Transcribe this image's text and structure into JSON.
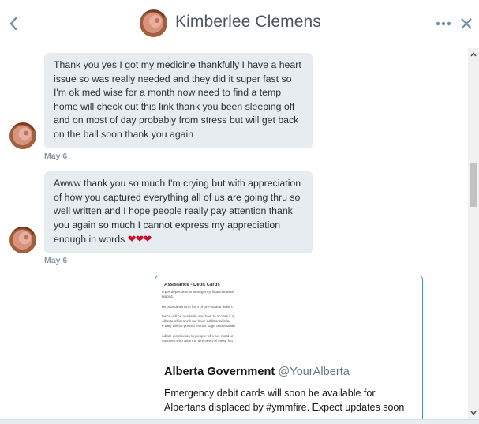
{
  "header": {
    "title": "Kimberlee Clemens",
    "back_icon": "chevron-left-icon",
    "more_icon": "more-icon",
    "close_icon": "close-icon"
  },
  "messages": [
    {
      "text": "Thank you yes I got my medicine thankfully I have a heart issue so was really needed and they did it super fast so I'm ok med wise for a month now need to find a temp home will check out this link thank you been sleeping off and on most of day probably from stress but will get back on the ball soon thank you again",
      "date": "May 6"
    },
    {
      "text": "Awww thank you so much I'm crying but with appreciation of how you captured everything all of us are going thru so well written and I hope people really pay attention thank you again so much I cannot express my appreciation enough in words",
      "emoji": "❤❤❤",
      "date": "May 6"
    }
  ],
  "tweet": {
    "image_title": "Assistance - Debit Cards",
    "image_lines": [
      "0 per dependent in emergency financial assis",
      "placed.",
      "",
      "be provided in the form of pre-loaded debit c",
      "",
      "tance will be available and how to access it w",
      "Alberta offices will not have additional infor",
      "e they will be posted on this page and availab",
      "",
      "ediate distribution to people who are most ur",
      "vacuees who aren't in dire need of these fun"
    ],
    "author_name": "Alberta Government",
    "author_handle": "@YourAlberta",
    "text": "Emergency debit cards will soon be available for Albertans displaced by #ymmfire. Expect updates soon"
  },
  "colors": {
    "bubble": "#e6ecf0",
    "card_border": "#2aa0c7",
    "date": "#8899a6",
    "heart": "#c8102e"
  }
}
